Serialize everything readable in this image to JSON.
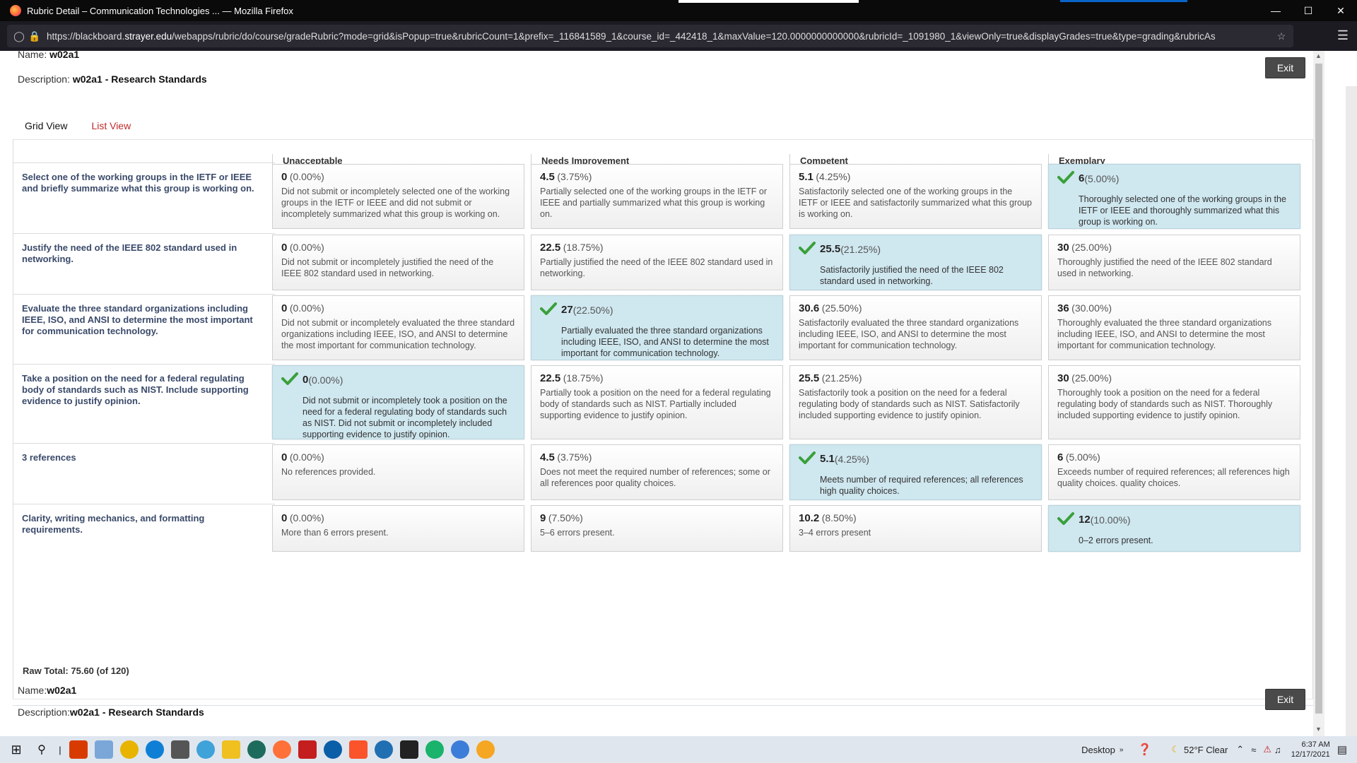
{
  "window": {
    "title": "Rubric Detail – Communication Technologies ... — Mozilla Firefox",
    "url_prefix": "https://blackboard.",
    "url_domain": "strayer.edu",
    "url_rest": "/webapps/rubric/do/course/gradeRubric?mode=grid&isPopup=true&rubricCount=1&prefix=_116841589_1&course_id=_442418_1&maxValue=120.0000000000000&rubricId=_1091980_1&viewOnly=true&displayGrades=true&type=grading&rubricAs"
  },
  "header": {
    "name_label": "Name:",
    "name_value": "w02a1",
    "description_label": "Description:",
    "description_value": "w02a1 - Research Standards",
    "exit_label": "Exit"
  },
  "tabs": [
    {
      "label": "Grid View",
      "active": true
    },
    {
      "label": "List View",
      "active": false
    }
  ],
  "columns": [
    "Unacceptable",
    "Needs Improvement",
    "Competent",
    "Exemplary"
  ],
  "rows": [
    {
      "criterion": "Select one of the working groups in the IETF or IEEE and briefly summarize what this group is working on.",
      "cells": [
        {
          "score": "0",
          "pct": "(0.00%)",
          "desc": "Did not submit or incompletely selected one of the working groups in the IETF or IEEE and did not submit or incompletely summarized what this group is working on."
        },
        {
          "score": "4.5",
          "pct": "(3.75%)",
          "desc": "Partially selected one of the working groups in the IETF or IEEE and partially summarized what this group is working on."
        },
        {
          "score": "5.1",
          "pct": "(4.25%)",
          "desc": "Satisfactorily selected one of the working groups in the IETF or IEEE and satisfactorily summarized what this group is working on."
        },
        {
          "score": "6",
          "pct": "(5.00%)",
          "desc": "Thoroughly selected one of the working groups in the IETF or IEEE and thoroughly summarized what this group is working on."
        }
      ],
      "selected": 3
    },
    {
      "criterion": "Justify the need of the IEEE 802 standard used in networking.",
      "cells": [
        {
          "score": "0",
          "pct": "(0.00%)",
          "desc": "Did not submit or incompletely justified the need of the IEEE 802 standard used in networking."
        },
        {
          "score": "22.5",
          "pct": "(18.75%)",
          "desc": "Partially justified the need of the IEEE 802 standard used in networking."
        },
        {
          "score": "25.5",
          "pct": "(21.25%)",
          "desc": "Satisfactorily justified the need of the IEEE 802 standard used in networking."
        },
        {
          "score": "30",
          "pct": "(25.00%)",
          "desc": "Thoroughly justified the need of the IEEE 802 standard used in networking."
        }
      ],
      "selected": 2
    },
    {
      "criterion": "Evaluate the three standard organizations including IEEE, ISO, and ANSI to determine the most important for communication technology.",
      "cells": [
        {
          "score": "0",
          "pct": "(0.00%)",
          "desc": "Did not submit or incompletely evaluated the three standard organizations including IEEE, ISO, and ANSI to determine the most important for communication technology."
        },
        {
          "score": "27",
          "pct": "(22.50%)",
          "desc": "Partially evaluated the three standard organizations including IEEE, ISO, and ANSI to determine the most important for communication technology."
        },
        {
          "score": "30.6",
          "pct": "(25.50%)",
          "desc": "Satisfactorily evaluated the three standard organizations including IEEE, ISO, and ANSI to determine the most important for communication technology."
        },
        {
          "score": "36",
          "pct": "(30.00%)",
          "desc": "Thoroughly evaluated the three standard organizations including IEEE, ISO, and ANSI to determine the most important for communication technology."
        }
      ],
      "selected": 1
    },
    {
      "criterion": "Take a position on the need for a federal regulating body of standards such as NIST. Include supporting evidence to justify opinion.",
      "cells": [
        {
          "score": "0",
          "pct": "(0.00%)",
          "desc": "Did not submit or incompletely took a position on the need for a federal regulating body of standards such as NIST. Did not submit or incompletely included supporting evidence to justify opinion."
        },
        {
          "score": "22.5",
          "pct": "(18.75%)",
          "desc": "Partially took a position on the need for a federal regulating body of standards such as NIST. Partially included supporting evidence to justify opinion."
        },
        {
          "score": "25.5",
          "pct": "(21.25%)",
          "desc": "Satisfactorily took a position on the need for a federal regulating body of standards such as NIST. Satisfactorily included supporting evidence to justify opinion."
        },
        {
          "score": "30",
          "pct": "(25.00%)",
          "desc": "Thoroughly took a position on the need for a federal regulating body of standards such as NIST. Thoroughly included supporting evidence to justify opinion."
        }
      ],
      "selected": 0
    },
    {
      "criterion": "3 references",
      "cells": [
        {
          "score": "0",
          "pct": "(0.00%)",
          "desc": "No references provided."
        },
        {
          "score": "4.5",
          "pct": "(3.75%)",
          "desc": "Does not meet the required number of references; some or all references poor quality choices."
        },
        {
          "score": "5.1",
          "pct": "(4.25%)",
          "desc": "Meets number of required references; all references high quality choices."
        },
        {
          "score": "6",
          "pct": "(5.00%)",
          "desc": "Exceeds number of required references; all references high quality choices. quality choices."
        }
      ],
      "selected": 2
    },
    {
      "criterion": "Clarity, writing mechanics, and formatting requirements.",
      "cells": [
        {
          "score": "0",
          "pct": "(0.00%)",
          "desc": "More than 6 errors present."
        },
        {
          "score": "9",
          "pct": "(7.50%)",
          "desc": "5–6 errors present."
        },
        {
          "score": "10.2",
          "pct": "(8.50%)",
          "desc": "3–4 errors present"
        },
        {
          "score": "12",
          "pct": "(10.00%)",
          "desc": "0–2 errors present."
        }
      ],
      "selected": 3
    }
  ],
  "footer": {
    "raw_total": "Raw Total: 75.60 (of 120)",
    "name_label": "Name:",
    "name_value": "w02a1",
    "description_label": "Description:",
    "description_value": "w02a1 - Research Standards",
    "exit_label": "Exit"
  },
  "taskbar": {
    "desktop_label": "Desktop",
    "weather": "52°F  Clear",
    "time": "6:37 AM",
    "date": "12/17/2021"
  },
  "colors": {
    "selected_cell": "#cfe7ef",
    "check_green": "#3aa03a",
    "link_red": "#c02b2b"
  }
}
